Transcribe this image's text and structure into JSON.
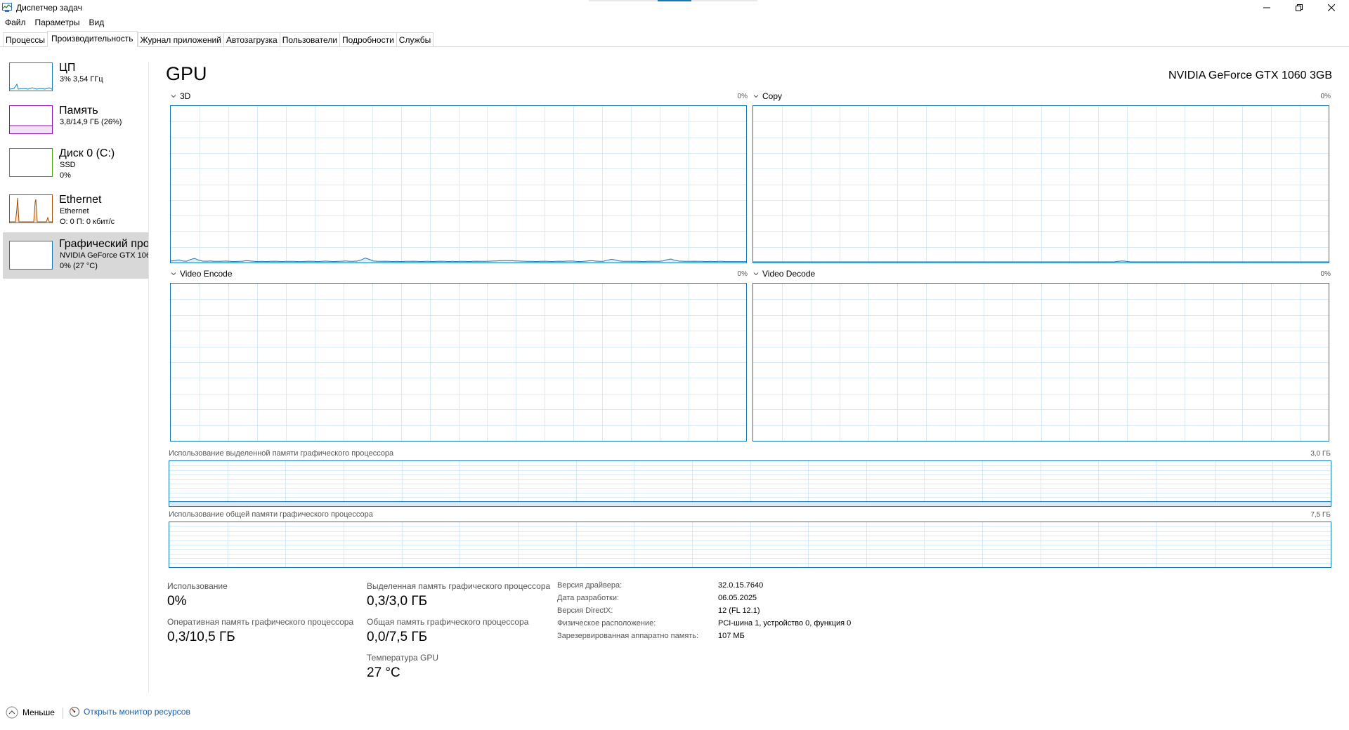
{
  "window": {
    "title": "Диспетчер задач"
  },
  "menu": [
    "Файл",
    "Параметры",
    "Вид"
  ],
  "tabs": [
    {
      "label": "Процессы",
      "active": false
    },
    {
      "label": "Производительность",
      "active": true
    },
    {
      "label": "Журнал приложений",
      "active": false
    },
    {
      "label": "Автозагрузка",
      "active": false
    },
    {
      "label": "Пользователи",
      "active": false
    },
    {
      "label": "Подробности",
      "active": false
    },
    {
      "label": "Службы",
      "active": false
    }
  ],
  "sidebar": {
    "items": [
      {
        "name": "ЦП",
        "line1": "3% 3,54 ГГц",
        "line2": "",
        "color": "#117dbb"
      },
      {
        "name": "Память",
        "line1": "3,8/14,9 ГБ (26%)",
        "line2": "",
        "color": "#8b12ae"
      },
      {
        "name": "Диск 0 (C:)",
        "line1": "SSD",
        "line2": "0%",
        "color": "#4da60c"
      },
      {
        "name": "Ethernet",
        "line1": "Ethernet",
        "line2": "О: 0 П: 0 кбит/с",
        "color": "#a74f01"
      },
      {
        "name": "Графический про",
        "line1": "NVIDIA GeForce GTX 106",
        "line2": "0% (27 °C)",
        "color": "#1779b4"
      }
    ]
  },
  "main": {
    "title": "GPU",
    "model": "NVIDIA GeForce GTX 1060 3GB",
    "engines": [
      {
        "label": "3D",
        "pct": "0%",
        "series": [
          0.5,
          0.8,
          1.2,
          0.6,
          0.4,
          1.5,
          2.2,
          1.1,
          0.5,
          0.4,
          0.6,
          0.3,
          0.3,
          0.4,
          0.5,
          0.3,
          0.2,
          0.3,
          0.4,
          0.8,
          0.6,
          0.3,
          0.2,
          0.3,
          0.2,
          0.3,
          0.4,
          0.3,
          0.2,
          0.3,
          0.3,
          0.3,
          0.2,
          0.2,
          0.3,
          0.4,
          0.3,
          0.2,
          0.3,
          0.5,
          0.3,
          0.2,
          0.3,
          0.4,
          0.6,
          0.4,
          0.3,
          0.5,
          1.2,
          2.4,
          1.6,
          0.6,
          0.4,
          0.3,
          0.4,
          0.3,
          0.2,
          0.3,
          0.2,
          0.3,
          0.3,
          0.4,
          0.3,
          0.2,
          0.3,
          0.3,
          0.2,
          0.3,
          0.4,
          0.3,
          0.2,
          0.3,
          0.2,
          0.3,
          0.3,
          0.2,
          0.3,
          0.4,
          0.3,
          0.3,
          0.4,
          0.5,
          0.6,
          0.7,
          0.8,
          0.8,
          0.7,
          0.6,
          0.5,
          0.4,
          0.3,
          0.3,
          0.2,
          0.3,
          0.4,
          0.3,
          0.2,
          0.3,
          0.4,
          0.3,
          0.5,
          0.6,
          0.3,
          0.2,
          0.3,
          0.6,
          0.8,
          0.5,
          0.3,
          0.4,
          1.0,
          1.6,
          1.2,
          0.6,
          0.4,
          0.3,
          0.3,
          0.4,
          0.3,
          0.2,
          0.3,
          0.4,
          0.3,
          0.3,
          0.6,
          1.3,
          1.8,
          1.0,
          0.5,
          0.4,
          0.3,
          0.3,
          0.4,
          0.3,
          0.3,
          0.2,
          0.3,
          0.2,
          0.3,
          0.3,
          0.2,
          0.2,
          0.2,
          0.2,
          0.2,
          0.2
        ]
      },
      {
        "label": "Copy",
        "pct": "0%",
        "series": [
          0,
          0,
          0,
          0,
          0,
          0,
          0,
          0,
          0,
          0,
          0,
          0,
          0,
          0,
          0,
          0,
          0,
          0,
          0,
          0,
          0,
          0,
          0,
          0,
          0,
          0,
          0,
          0,
          0,
          0,
          0,
          0,
          0,
          0,
          0,
          0,
          0,
          0,
          0,
          0,
          0,
          0,
          0,
          0,
          0,
          0,
          0,
          0,
          0,
          0,
          0,
          0,
          0,
          0,
          0,
          0,
          0,
          0,
          0,
          0,
          0,
          0,
          0,
          0,
          0,
          0,
          0,
          0,
          0,
          0,
          0,
          0,
          0,
          0,
          0,
          0,
          0,
          0,
          0,
          0,
          0,
          0,
          0,
          0,
          0,
          0,
          0,
          0,
          0,
          0,
          0,
          0,
          0.3,
          0.6,
          0.3,
          0,
          0,
          0,
          0,
          0,
          0,
          0,
          0,
          0,
          0,
          0,
          0,
          0,
          0,
          0,
          0,
          0,
          0,
          0,
          0,
          0,
          0,
          0,
          0,
          0,
          0,
          0,
          0,
          0,
          0,
          0,
          0,
          0,
          0,
          0,
          0,
          0,
          0,
          0,
          0,
          0,
          0,
          0,
          0,
          0,
          0,
          0,
          0,
          0,
          0,
          0
        ]
      },
      {
        "label": "Video Encode",
        "pct": "0%",
        "series": []
      },
      {
        "label": "Video Decode",
        "pct": "0%",
        "series": []
      }
    ],
    "dedicated_mem": {
      "label": "Использование выделенной памяти графического процессора",
      "max": "3,0 ГБ",
      "fraction": 0.1
    },
    "shared_mem": {
      "label": "Использование общей памяти графического процессора",
      "max": "7,5 ГБ",
      "fraction": 0.0
    }
  },
  "stats": {
    "usage_label": "Использование",
    "usage_value": "0%",
    "dedicated_label": "Выделенная память графического процессора",
    "dedicated_value": "0,3/3,0 ГБ",
    "gpu_mem_label": "Оперативная память графического процессора",
    "gpu_mem_value": "0,3/10,5 ГБ",
    "shared_label": "Общая память графического процессора",
    "shared_value": "0,0/7,5 ГБ",
    "temp_label": "Температура GPU",
    "temp_value": "27 °C"
  },
  "info": [
    {
      "label": "Версия драйвера:",
      "value": "32.0.15.7640"
    },
    {
      "label": "Дата разработки:",
      "value": "06.05.2025"
    },
    {
      "label": "Версия DirectX:",
      "value": "12 (FL 12.1)"
    },
    {
      "label": "Физическое расположение:",
      "value": "PCI-шина 1, устройство 0, функция 0"
    },
    {
      "label": "Зарезервированная аппаратно память:",
      "value": "107 МБ"
    }
  ],
  "footer": {
    "fewer_label": "Меньше",
    "resmon_label": "Открыть монитор ресурсов"
  },
  "colors": {
    "gpu_accent": "#1779b4",
    "grid": "#d9eaf7",
    "link": "#1a5fa8"
  },
  "icons": [
    "task-manager-icon",
    "minimize-icon",
    "maximize-icon",
    "close-icon",
    "chevron-down-icon",
    "chevron-up-icon",
    "resource-monitor-icon"
  ]
}
